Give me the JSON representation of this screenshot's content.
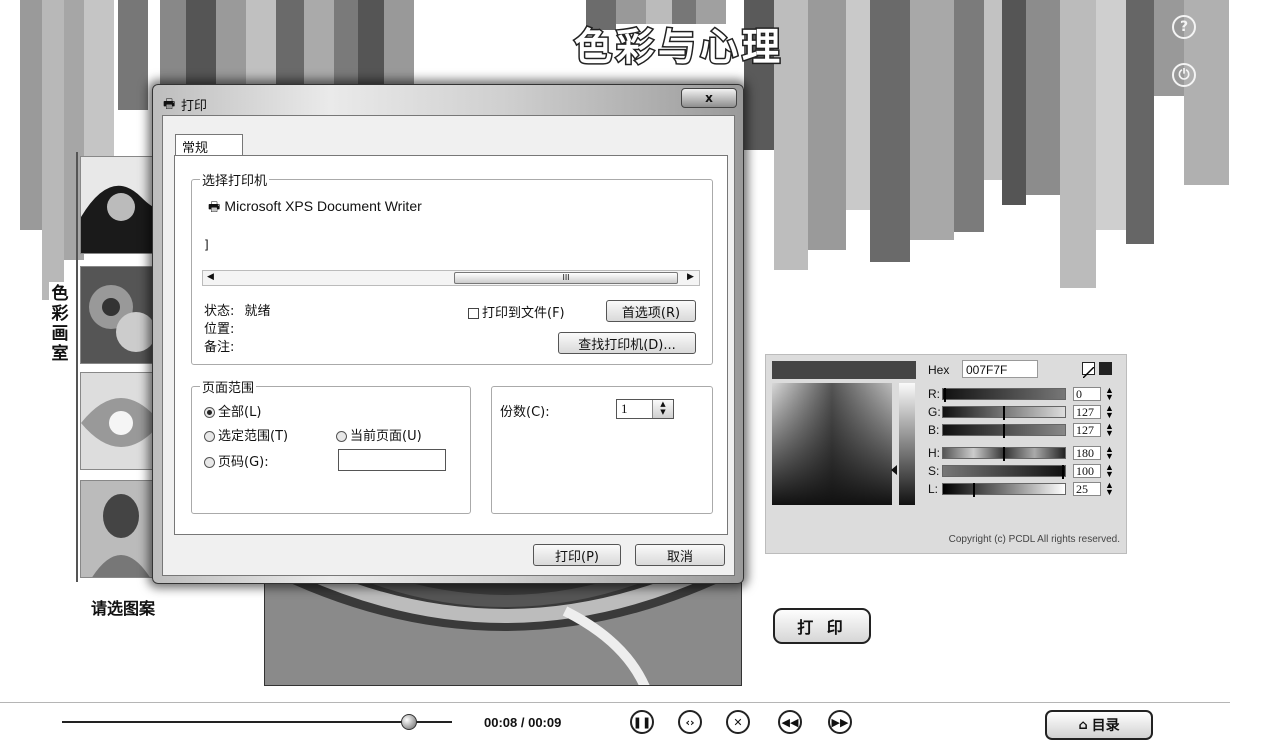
{
  "app": {
    "title": "色彩与心理",
    "help_icon": "question-circle-icon",
    "power_icon": "power-icon",
    "side_label": "色彩画室",
    "choose_label": "请选图案",
    "print_button": "打 印",
    "time": "00:08 / 00:09",
    "playback_progress": 0.89,
    "menu_button": "目录",
    "menu_icon": "home-icon",
    "controls": [
      "pause-icon",
      "replay-icon",
      "stop-icon",
      "rewind-icon",
      "forward-icon"
    ]
  },
  "color_picker": {
    "hex_label": "Hex",
    "hex_value": "007F7F",
    "rows": [
      {
        "label": "R:",
        "value": "0"
      },
      {
        "label": "G:",
        "value": "127"
      },
      {
        "label": "B:",
        "value": "127"
      },
      {
        "label": "H:",
        "value": "180"
      },
      {
        "label": "S:",
        "value": "100"
      },
      {
        "label": "L:",
        "value": "25"
      }
    ],
    "copyright": "Copyright (c) PCDL All rights reserved."
  },
  "print_dialog": {
    "title": "打印",
    "close": "x",
    "tab": "常规",
    "select_printer": "选择打印机",
    "printer_name": "Microsoft XPS Document Writer",
    "scroll_mark": "III",
    "status_label": "状态:",
    "status_value": "就绪",
    "location_label": "位置:",
    "comment_label": "备注:",
    "print_to_file": "打印到文件(F)",
    "preferences": "首选项(R)",
    "find_printer": "查找打印机(D)...",
    "page_range": "页面范围",
    "all": "全部(L)",
    "selection": "选定范围(T)",
    "current_page": "当前页面(U)",
    "pages": "页码(G):",
    "copies_label": "份数(C):",
    "copies_value": "1",
    "print_btn": "打印(P)",
    "cancel_btn": "取消"
  }
}
